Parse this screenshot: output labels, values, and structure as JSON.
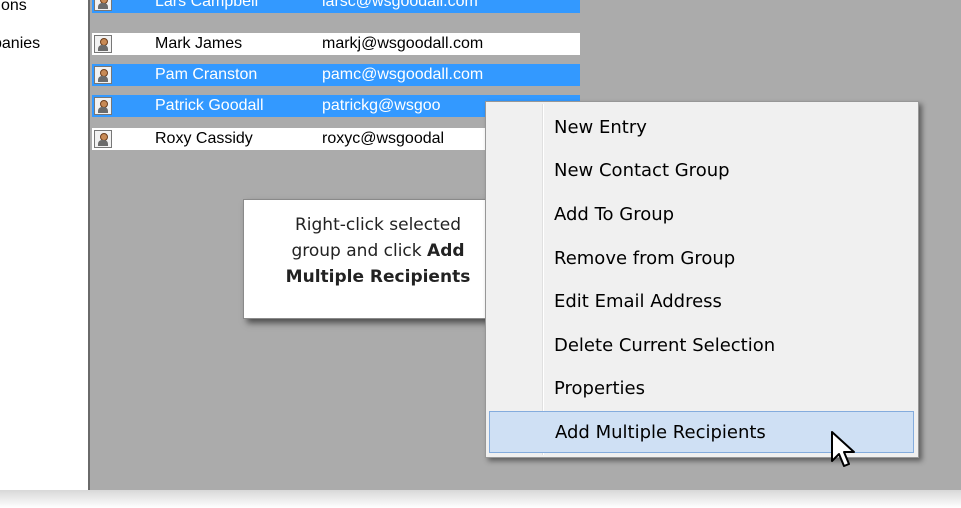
{
  "tree": {
    "items": [
      {
        "label": "tions"
      },
      {
        "label": "panies"
      }
    ]
  },
  "contacts": [
    {
      "name": "Lars Campbell",
      "email": "larsc@wsgoodall.com",
      "selected": true
    },
    {
      "name": "Mark James",
      "email": "markj@wsgoodall.com",
      "selected": false
    },
    {
      "name": "Pam Cranston",
      "email": "pamc@wsgoodall.com",
      "selected": true
    },
    {
      "name": "Patrick Goodall",
      "email": "patrickg@wsgoo",
      "selected": true
    },
    {
      "name": "Roxy Cassidy",
      "email": "roxyc@wsgoodal",
      "selected": false
    }
  ],
  "callout": {
    "line1": "Right-click selected",
    "line2": "group and click ",
    "line2_bold": "Add",
    "line3_bold": "Multiple Recipients"
  },
  "context_menu": {
    "items": [
      {
        "label": "New Entry"
      },
      {
        "label": "New Contact Group"
      },
      {
        "label": "Add To Group"
      },
      {
        "label": "Remove from Group"
      },
      {
        "label": "Edit Email Address"
      },
      {
        "label": "Delete Current Selection"
      },
      {
        "label": "Properties"
      },
      {
        "label": "Add Multiple Recipients",
        "highlighted": true
      }
    ]
  },
  "colors": {
    "selection": "#3399ff",
    "pane_background": "#ababab",
    "menu_highlight": "#cfe0f4"
  },
  "icons": {
    "contact": "contact-card-icon",
    "cursor": "mouse-pointer-icon"
  }
}
